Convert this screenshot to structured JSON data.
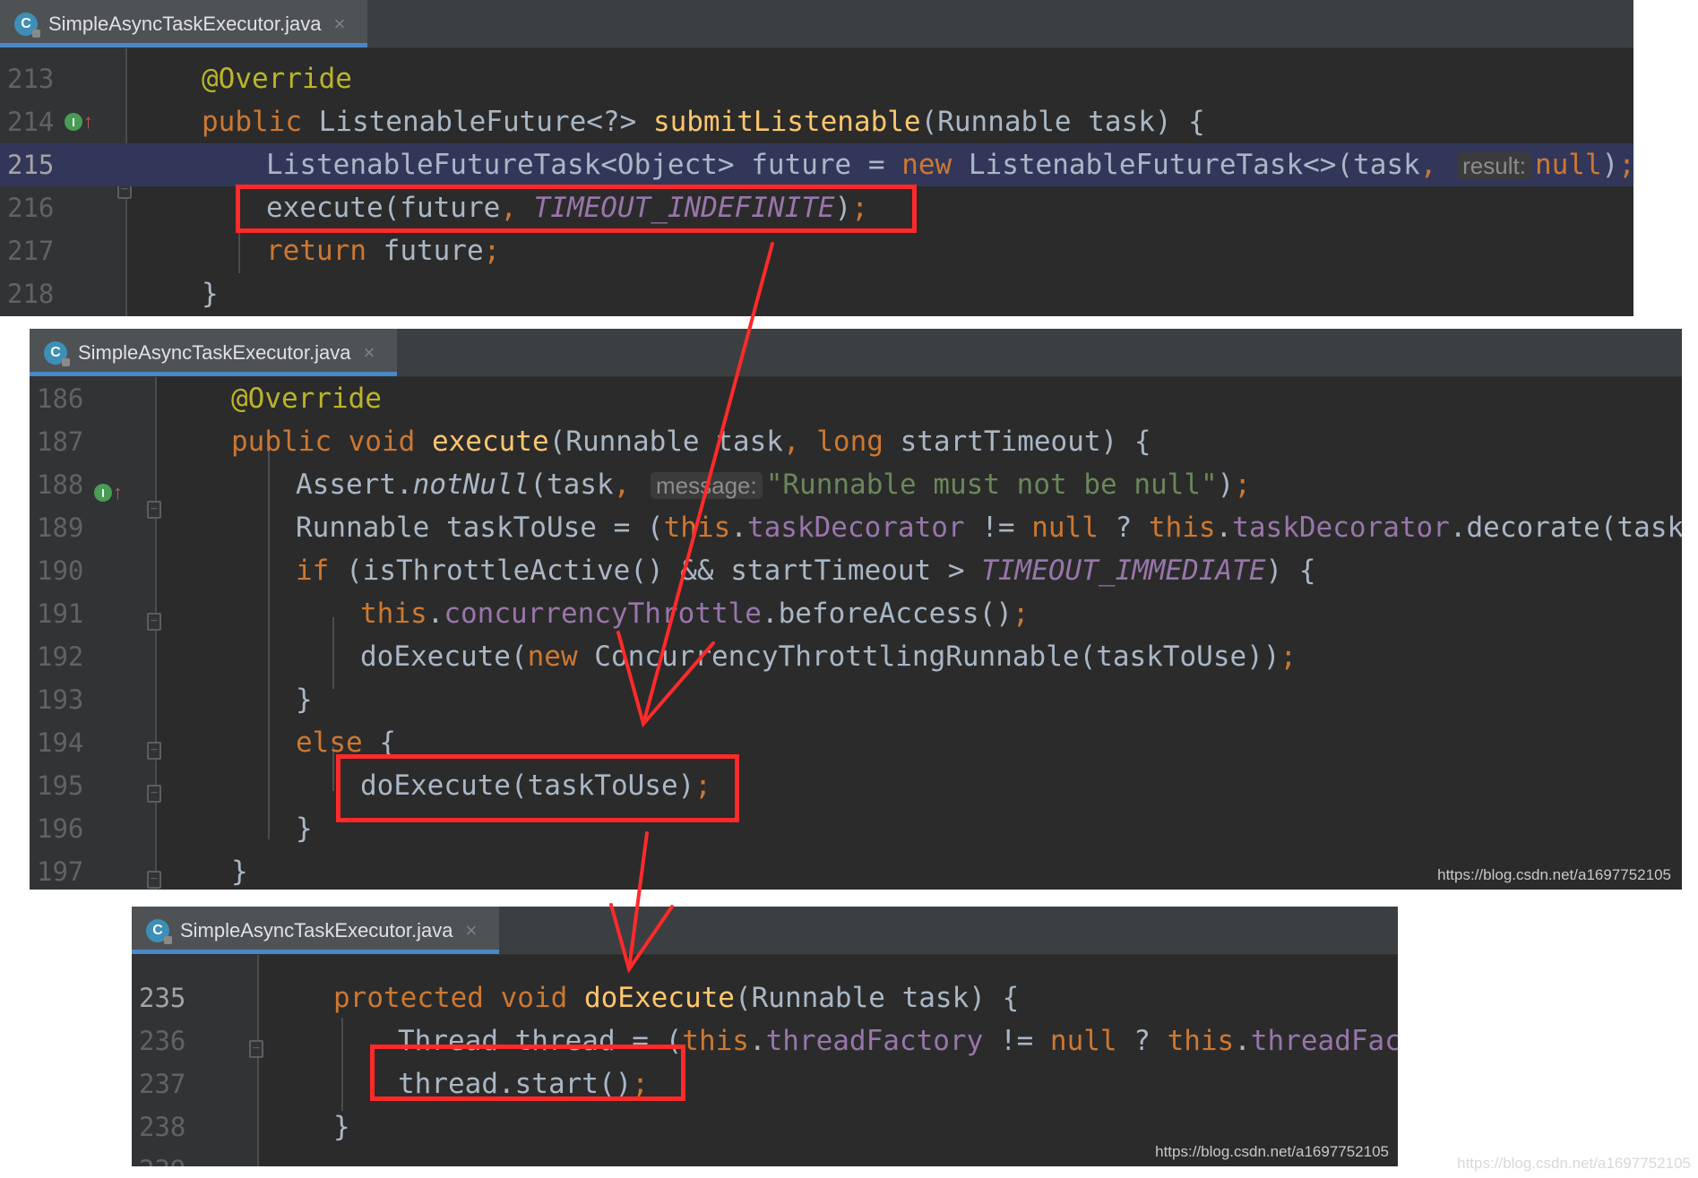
{
  "tab_filename": "SimpleAsyncTaskExecutor.java",
  "tab_icon_letter": "C",
  "tab_close_glyph": "×",
  "highlight_color": "#ff2a2a",
  "snippet1": {
    "lines": [
      {
        "n": "213",
        "t": [
          {
            "c": "ann",
            "v": "@Override"
          }
        ]
      },
      {
        "n": "214",
        "t": [
          {
            "c": "k",
            "v": "public "
          },
          {
            "v": "ListenableFuture<?> "
          },
          {
            "c": "fn",
            "v": "submitListenable"
          },
          {
            "v": "(Runnable task) {"
          }
        ]
      },
      {
        "n": "215",
        "t": [
          {
            "v": "ListenableFutureTask<Object> future = "
          },
          {
            "c": "k",
            "v": "new "
          },
          {
            "v": "ListenableFutureTask<>(task"
          },
          {
            "c": "k",
            "v": ","
          },
          {
            "v": " "
          },
          {
            "c": "hint",
            "v": "result:"
          },
          {
            "c": "k",
            "v": "null"
          },
          {
            "v": ")"
          },
          {
            "c": "k",
            "v": ";"
          }
        ]
      },
      {
        "n": "216",
        "t": [
          {
            "v": "execute(future"
          },
          {
            "c": "k",
            "v": ", "
          },
          {
            "c": "cst",
            "v": "TIMEOUT_INDEFINITE"
          },
          {
            "v": ")"
          },
          {
            "c": "k",
            "v": ";"
          }
        ]
      },
      {
        "n": "217",
        "t": [
          {
            "c": "k",
            "v": "return "
          },
          {
            "v": "future"
          },
          {
            "c": "k",
            "v": ";"
          }
        ]
      },
      {
        "n": "218",
        "t": [
          {
            "v": "}"
          }
        ]
      }
    ]
  },
  "snippet2": {
    "lines": [
      {
        "n": "186",
        "t": [
          {
            "c": "ann",
            "v": "@Override"
          }
        ]
      },
      {
        "n": "187",
        "t": [
          {
            "c": "k",
            "v": "public void "
          },
          {
            "c": "fn",
            "v": "execute"
          },
          {
            "v": "(Runnable task"
          },
          {
            "c": "k",
            "v": ", long "
          },
          {
            "v": "startTimeout) {"
          }
        ]
      },
      {
        "n": "188",
        "t": [
          {
            "v": "Assert."
          },
          {
            "c": "st",
            "v": "notNull"
          },
          {
            "v": "(task"
          },
          {
            "c": "k",
            "v": ","
          },
          {
            "v": " "
          },
          {
            "c": "hint",
            "v": "message:"
          },
          {
            "c": "str",
            "v": "\"Runnable must not be null\""
          },
          {
            "v": ")"
          },
          {
            "c": "k",
            "v": ";"
          }
        ]
      },
      {
        "n": "189",
        "t": [
          {
            "v": "Runnable taskToUse = ("
          },
          {
            "c": "k",
            "v": "this"
          },
          {
            "v": "."
          },
          {
            "c": "fld",
            "v": "taskDecorator"
          },
          {
            "v": " != "
          },
          {
            "c": "k",
            "v": "null "
          },
          {
            "v": "? "
          },
          {
            "c": "k",
            "v": "this"
          },
          {
            "v": "."
          },
          {
            "c": "fld",
            "v": "taskDecorator"
          },
          {
            "v": ".decorate(task) : task)"
          },
          {
            "c": "k",
            "v": ";"
          }
        ]
      },
      {
        "n": "190",
        "t": [
          {
            "c": "k",
            "v": "if "
          },
          {
            "v": "(isThrottleActive() && startTimeout > "
          },
          {
            "c": "cst",
            "v": "TIMEOUT_IMMEDIATE"
          },
          {
            "v": ") {"
          }
        ]
      },
      {
        "n": "191",
        "t": [
          {
            "c": "k",
            "v": "this"
          },
          {
            "v": "."
          },
          {
            "c": "fld",
            "v": "concurrencyThrottle"
          },
          {
            "v": ".beforeAccess()"
          },
          {
            "c": "k",
            "v": ";"
          }
        ]
      },
      {
        "n": "192",
        "t": [
          {
            "v": "doExecute("
          },
          {
            "c": "k",
            "v": "new "
          },
          {
            "v": "ConcurrencyThrottlingRunnable(taskToUse))"
          },
          {
            "c": "k",
            "v": ";"
          }
        ]
      },
      {
        "n": "193",
        "t": [
          {
            "v": "}"
          }
        ]
      },
      {
        "n": "194",
        "t": [
          {
            "c": "k",
            "v": "else "
          },
          {
            "v": "{"
          }
        ]
      },
      {
        "n": "195",
        "t": [
          {
            "v": "doExecute(taskToUse)"
          },
          {
            "c": "k",
            "v": ";"
          }
        ]
      },
      {
        "n": "196",
        "t": [
          {
            "v": "}"
          }
        ]
      },
      {
        "n": "197",
        "t": [
          {
            "v": "}"
          }
        ]
      }
    ],
    "watermark": "https://blog.csdn.net/a1697752105"
  },
  "snippet3": {
    "lines": [
      {
        "n": "235",
        "t": [
          {
            "c": "k",
            "v": "protected void "
          },
          {
            "c": "fn",
            "v": "doExecute"
          },
          {
            "v": "(Runnable task) {"
          }
        ]
      },
      {
        "n": "236",
        "t": [
          {
            "v": "Thread thread = ("
          },
          {
            "c": "k",
            "v": "this"
          },
          {
            "v": "."
          },
          {
            "c": "fld",
            "v": "threadFactory"
          },
          {
            "v": " != "
          },
          {
            "c": "k",
            "v": "null "
          },
          {
            "v": "? "
          },
          {
            "c": "k",
            "v": "this"
          },
          {
            "v": "."
          },
          {
            "c": "fld",
            "v": "threadFactory"
          },
          {
            "v": ".newThread(task) : createThread(task))"
          },
          {
            "c": "k",
            "v": ";"
          }
        ]
      },
      {
        "n": "237",
        "t": [
          {
            "v": "thread.start()"
          },
          {
            "c": "k",
            "v": ";"
          }
        ]
      },
      {
        "n": "238",
        "t": [
          {
            "v": "}"
          }
        ]
      },
      {
        "n": "239",
        "t": []
      }
    ],
    "watermark": "https://blog.csdn.net/a1697752105"
  },
  "page_watermark": "https://blog.csdn.net/a1697752105"
}
